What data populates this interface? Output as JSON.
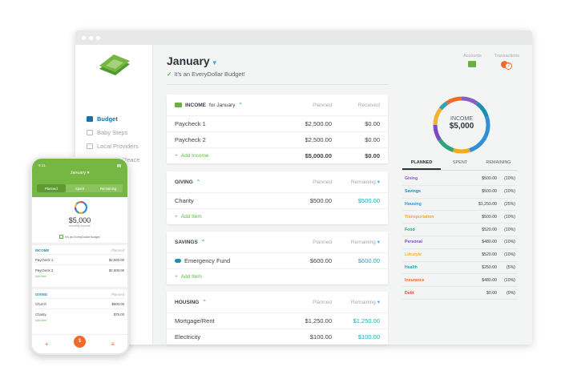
{
  "header": {
    "month": "January",
    "subtitle": "It's an EveryDollar Budget!"
  },
  "top_icons": [
    {
      "label": "Accounts"
    },
    {
      "label": "Transactions",
      "badge": "2"
    }
  ],
  "sidebar": {
    "items": [
      {
        "label": "Budget",
        "active": true
      },
      {
        "label": "Baby Steps"
      },
      {
        "label": "Local Providers"
      },
      {
        "label": "Financial Peace"
      }
    ]
  },
  "cards": {
    "income": {
      "name": "INCOME",
      "period": "for January",
      "col1": "Planned",
      "col2": "Received",
      "rows": [
        {
          "label": "Paycheck 1",
          "planned": "$2,500.00",
          "other": "$0.00"
        },
        {
          "label": "Paycheck 2",
          "planned": "$2,500.00",
          "other": "$0.00"
        }
      ],
      "add_label": "Add Income",
      "total_planned": "$5,000.00",
      "total_other": "$0.00"
    },
    "giving": {
      "name": "GIVING",
      "col1": "Planned",
      "col2": "Remaining",
      "rows": [
        {
          "label": "Charity",
          "planned": "$500.00",
          "other": "$500.00"
        }
      ],
      "add_label": "Add Item"
    },
    "savings": {
      "name": "SAVINGS",
      "col1": "Planned",
      "col2": "Remaining",
      "rows": [
        {
          "label": "Emergency Fund",
          "planned": "$600.00",
          "other": "$600.00"
        }
      ],
      "add_label": "Add Item"
    },
    "housing": {
      "name": "HOUSING",
      "col1": "Planned",
      "col2": "Remaining",
      "rows": [
        {
          "label": "Mortgage/Rent",
          "planned": "$1,250.00",
          "other": "$1,250.00"
        },
        {
          "label": "Electricity",
          "planned": "$100.00",
          "other": "$100.00"
        }
      ]
    }
  },
  "summary": {
    "donut_label": "INCOME",
    "donut_amount": "$5,000",
    "tabs": [
      "PLANNED",
      "SPENT",
      "REMAINING"
    ],
    "categories": [
      {
        "name": "Giving",
        "value": "$500.00",
        "pct": "(10%)",
        "color": "#8b5cc7"
      },
      {
        "name": "Savings",
        "value": "$500.00",
        "pct": "(10%)",
        "color": "#1b8fb0"
      },
      {
        "name": "Housing",
        "value": "$1,250.00",
        "pct": "(25%)",
        "color": "#2f8fd8"
      },
      {
        "name": "Transportation",
        "value": "$500.00",
        "pct": "(10%)",
        "color": "#f5a623"
      },
      {
        "name": "Food",
        "value": "$520.00",
        "pct": "(10%)",
        "color": "#2fa37a"
      },
      {
        "name": "Personal",
        "value": "$480.00",
        "pct": "(10%)",
        "color": "#7b4cc0"
      },
      {
        "name": "Lifestyle",
        "value": "$520.00",
        "pct": "(10%)",
        "color": "#f2b233"
      },
      {
        "name": "Health",
        "value": "$250.00",
        "pct": "(5%)",
        "color": "#2aa3b6"
      },
      {
        "name": "Insurance",
        "value": "$480.00",
        "pct": "(10%)",
        "color": "#f26a2a"
      },
      {
        "name": "Debt",
        "value": "$0.00",
        "pct": "(0%)",
        "color": "#e04b4b"
      }
    ]
  },
  "phone": {
    "time": "9:41",
    "month": "January",
    "tabs": [
      "Planned",
      "Spent",
      "Remaining"
    ],
    "amount": "$5,000",
    "amount_label": "monthly income",
    "message": "It's an EveryDollar budget",
    "income": {
      "title": "INCOME",
      "col": "Planned",
      "rows": [
        {
          "label": "Paycheck 1",
          "value": "$2,500.00"
        },
        {
          "label": "Paycheck 2",
          "value": "$2,500.00"
        }
      ],
      "add": "Add Item"
    },
    "giving": {
      "title": "GIVING",
      "col": "Planned",
      "rows": [
        {
          "label": "Church",
          "value": "$500.00"
        },
        {
          "label": "Charity",
          "value": "$75.00"
        }
      ],
      "add": "Add Item"
    },
    "fab": "$"
  }
}
